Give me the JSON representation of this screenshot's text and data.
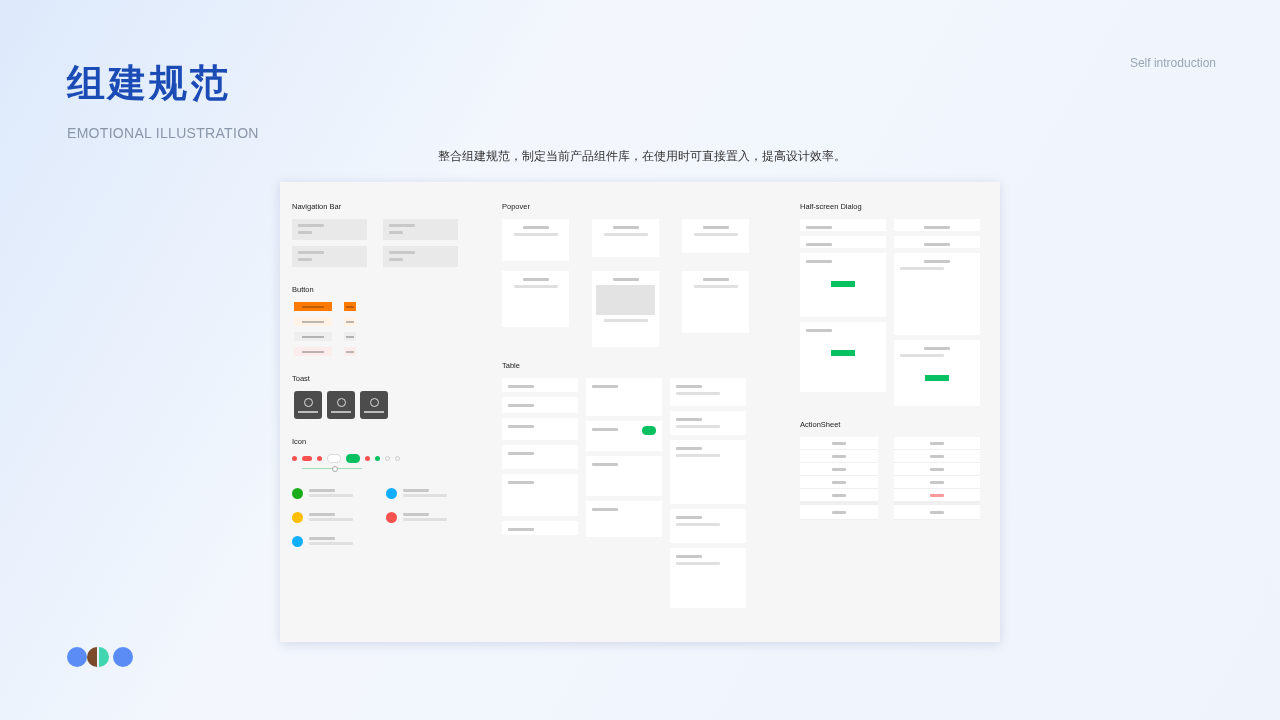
{
  "header": {
    "title": "组建规范",
    "subtitle": "EMOTIONAL ILLUSTRATION",
    "corner": "Self introduction",
    "description": "整合组建规范，制定当前产品组件库，在使用时可直接置入，提高设计效率。"
  },
  "columns": [
    [
      {
        "title": "Navigation Bar",
        "kind": "navbar"
      },
      {
        "title": "Button",
        "kind": "button"
      },
      {
        "title": "Toast",
        "kind": "toast"
      },
      {
        "title": "Icon",
        "kind": "icon"
      }
    ],
    [
      {
        "title": "Popover",
        "kind": "popover"
      },
      {
        "title": "Table",
        "kind": "table"
      }
    ],
    [
      {
        "title": "Half-screen Dialog",
        "kind": "dialog"
      },
      {
        "title": "ActionSheet",
        "kind": "actionsheet"
      }
    ]
  ]
}
